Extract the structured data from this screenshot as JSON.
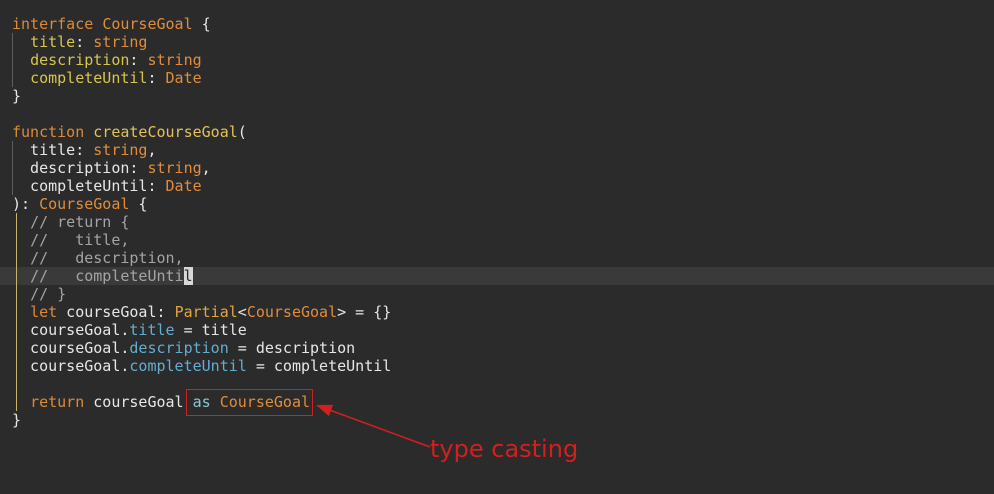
{
  "editor": {
    "active_line": 15,
    "lines": [
      [
        {
          "k": "kw",
          "t": "interface"
        },
        {
          "k": "plain",
          "t": " "
        },
        {
          "k": "type",
          "t": "CourseGoal"
        },
        {
          "k": "plain",
          "t": " {"
        }
      ],
      [
        {
          "k": "plain",
          "t": "  "
        },
        {
          "k": "prop",
          "t": "title"
        },
        {
          "k": "plain",
          "t": ": "
        },
        {
          "k": "type",
          "t": "string"
        }
      ],
      [
        {
          "k": "plain",
          "t": "  "
        },
        {
          "k": "prop",
          "t": "description"
        },
        {
          "k": "plain",
          "t": ": "
        },
        {
          "k": "type",
          "t": "string"
        }
      ],
      [
        {
          "k": "plain",
          "t": "  "
        },
        {
          "k": "prop",
          "t": "completeUntil"
        },
        {
          "k": "plain",
          "t": ": "
        },
        {
          "k": "type",
          "t": "Date"
        }
      ],
      [
        {
          "k": "plain",
          "t": "}"
        }
      ],
      [],
      [
        {
          "k": "kw",
          "t": "function"
        },
        {
          "k": "plain",
          "t": " "
        },
        {
          "k": "fn",
          "t": "createCourseGoal"
        },
        {
          "k": "plain",
          "t": "("
        }
      ],
      [
        {
          "k": "plain",
          "t": "  title: "
        },
        {
          "k": "type",
          "t": "string"
        },
        {
          "k": "plain",
          "t": ","
        }
      ],
      [
        {
          "k": "plain",
          "t": "  description: "
        },
        {
          "k": "type",
          "t": "string"
        },
        {
          "k": "plain",
          "t": ","
        }
      ],
      [
        {
          "k": "plain",
          "t": "  completeUntil: "
        },
        {
          "k": "type",
          "t": "Date"
        }
      ],
      [
        {
          "k": "plain",
          "t": "): "
        },
        {
          "k": "type",
          "t": "CourseGoal"
        },
        {
          "k": "plain",
          "t": " {"
        }
      ],
      [
        {
          "k": "plain",
          "t": "  "
        },
        {
          "k": "comment",
          "t": "// return {"
        }
      ],
      [
        {
          "k": "plain",
          "t": "  "
        },
        {
          "k": "comment",
          "t": "//   title,"
        }
      ],
      [
        {
          "k": "plain",
          "t": "  "
        },
        {
          "k": "comment",
          "t": "//   description,"
        }
      ],
      [
        {
          "k": "plain",
          "t": "  "
        },
        {
          "k": "comment",
          "t": "//   completeUnti"
        },
        {
          "k": "cursor",
          "t": "l"
        }
      ],
      [
        {
          "k": "plain",
          "t": "  "
        },
        {
          "k": "comment",
          "t": "// }"
        }
      ],
      [
        {
          "k": "plain",
          "t": "  "
        },
        {
          "k": "kw",
          "t": "let"
        },
        {
          "k": "plain",
          "t": " courseGoal: "
        },
        {
          "k": "builtin",
          "t": "Partial"
        },
        {
          "k": "plain",
          "t": "<"
        },
        {
          "k": "type",
          "t": "CourseGoal"
        },
        {
          "k": "plain",
          "t": "> = {}"
        }
      ],
      [
        {
          "k": "plain",
          "t": "  courseGoal."
        },
        {
          "k": "member",
          "t": "title"
        },
        {
          "k": "plain",
          "t": " = title"
        }
      ],
      [
        {
          "k": "plain",
          "t": "  courseGoal."
        },
        {
          "k": "member",
          "t": "description"
        },
        {
          "k": "plain",
          "t": " = description"
        }
      ],
      [
        {
          "k": "plain",
          "t": "  courseGoal."
        },
        {
          "k": "member",
          "t": "completeUntil"
        },
        {
          "k": "plain",
          "t": " = completeUntil"
        }
      ],
      [],
      [
        {
          "k": "plain",
          "t": "  "
        },
        {
          "k": "kw",
          "t": "return"
        },
        {
          "k": "plain",
          "t": " courseGoal "
        },
        {
          "k": "op",
          "t": "as"
        },
        {
          "k": "plain",
          "t": " "
        },
        {
          "k": "type",
          "t": "CourseGoal"
        }
      ],
      [
        {
          "k": "plain",
          "t": "}"
        }
      ]
    ]
  },
  "annotation": {
    "label": "type casting"
  },
  "colors": {
    "background": "#2b2b2b",
    "current_line": "#3a3a3a",
    "text": "#e6e6e6",
    "keyword": "#dd8a36",
    "type": "#e08d3c",
    "property": "#d8c54c",
    "function": "#e4c15a",
    "builtin": "#e2a63e",
    "member": "#62aed2",
    "operator": "#8cc6d4",
    "comment": "#a4a4a4",
    "cursor": "#d8d8d8",
    "indent_guide": "#5e5e5e",
    "scope_guide": "#c8b46a",
    "annotation": "#d21f1f"
  }
}
